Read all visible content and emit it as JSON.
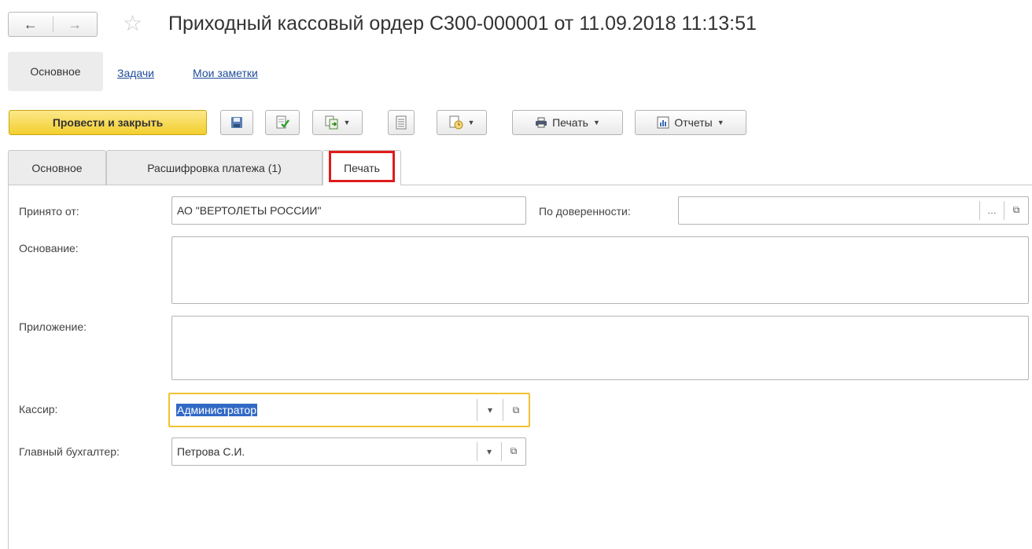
{
  "window": {
    "title": "Приходный кассовый ордер С300-000001 от 11.09.2018 11:13:51"
  },
  "nav": {
    "back_icon": "arrow-left-icon",
    "forward_icon": "arrow-right-icon",
    "favorite_icon": "star-icon"
  },
  "sections": {
    "main_label": "Основное",
    "tasks_label": "Задачи",
    "notes_label": "Мои заметки"
  },
  "toolbar": {
    "post_close_label": "Провести и закрыть",
    "print_label": "Печать",
    "reports_label": "Отчеты"
  },
  "tabs": [
    {
      "label": "Основное",
      "active": false
    },
    {
      "label": "Расшифровка платежа (1)",
      "active": false
    },
    {
      "label": "Печать",
      "active": true
    }
  ],
  "form": {
    "received_from_label": "Принято от:",
    "received_from_value": "АО \"ВЕРТОЛЕТЫ РОССИИ\"",
    "power_of_attorney_label": "По доверенности:",
    "power_of_attorney_value": "",
    "basis_label": "Основание:",
    "basis_value": "",
    "attachment_label": "Приложение:",
    "attachment_value": "",
    "cashier_label": "Кассир:",
    "cashier_value": "Администратор",
    "chief_accountant_label": "Главный бухгалтер:",
    "chief_accountant_value": "Петрова С.И."
  },
  "colors": {
    "primary_button": "#f3cf2e",
    "tab_highlight": "#e01b1b",
    "focused_field_border": "#f2c232",
    "selection": "#3169c6",
    "link": "#1f4c99"
  }
}
